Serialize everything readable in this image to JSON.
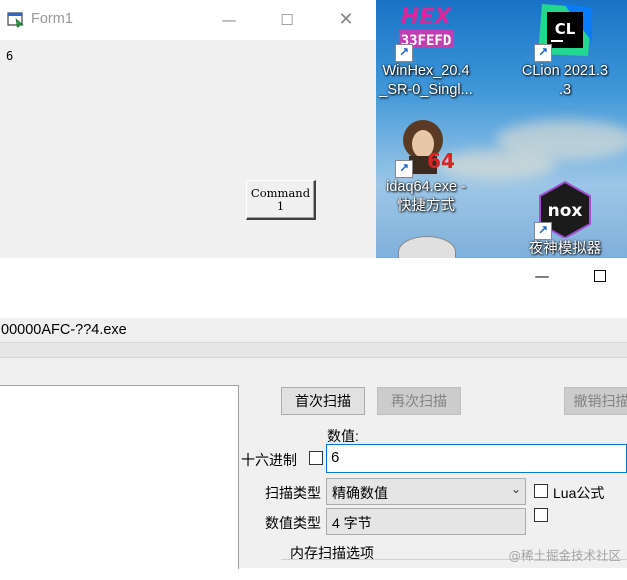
{
  "form1": {
    "title": "Form1",
    "label_value": "6",
    "command_button": "Command\n1"
  },
  "desktop": {
    "icons": [
      {
        "name": "winhex",
        "label": "WinHex_20.4\n_SR-0_Singl..."
      },
      {
        "name": "clion",
        "label": "CLion 2021.3\n.3"
      },
      {
        "name": "idaq64",
        "label": "idaq64.exe -\n快捷方式"
      },
      {
        "name": "nox",
        "label": "夜神模拟器"
      }
    ]
  },
  "cheat_engine": {
    "process_name": "00000AFC-??4.exe",
    "first_scan": "首次扫描",
    "next_scan": "再次扫描",
    "undo_scan": "撤销扫描",
    "value_label": "数值:",
    "hex_label": "十六进制",
    "value_input": "6",
    "scan_type_label": "扫描类型",
    "scan_type_value": "精确数值",
    "lua_formula": "Lua公式",
    "value_type_label": "数值类型",
    "value_type_value": "4 字节",
    "memory_scan_options": "内存扫描选项"
  },
  "watermark": "@稀土掘金技术社区",
  "colors": {
    "focus_border": "#0078d7",
    "disabled_text": "#838383"
  }
}
